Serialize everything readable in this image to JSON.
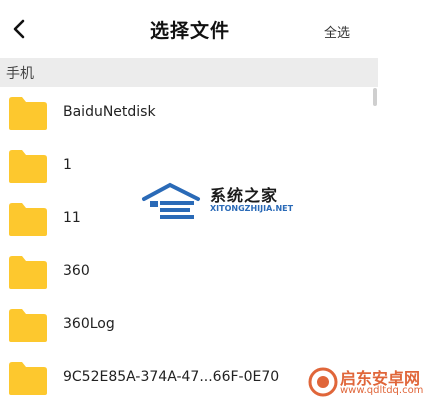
{
  "header": {
    "title": "选择文件",
    "select_all": "全选"
  },
  "section": {
    "label": "手机"
  },
  "files": [
    {
      "name": "BaiduNetdisk"
    },
    {
      "name": "1"
    },
    {
      "name": "11"
    },
    {
      "name": "360"
    },
    {
      "name": "360Log"
    },
    {
      "name": "9C52E85A-374A-47...66F-0E70"
    }
  ],
  "colors": {
    "folder": "#fdc82e",
    "section_bg": "#ececec"
  },
  "watermark": {
    "name": "系统之家",
    "url": "XITONGZHIJIA.NET"
  },
  "watermark2": {
    "name": "启东安卓网",
    "url": "www.qdltdq.com"
  }
}
